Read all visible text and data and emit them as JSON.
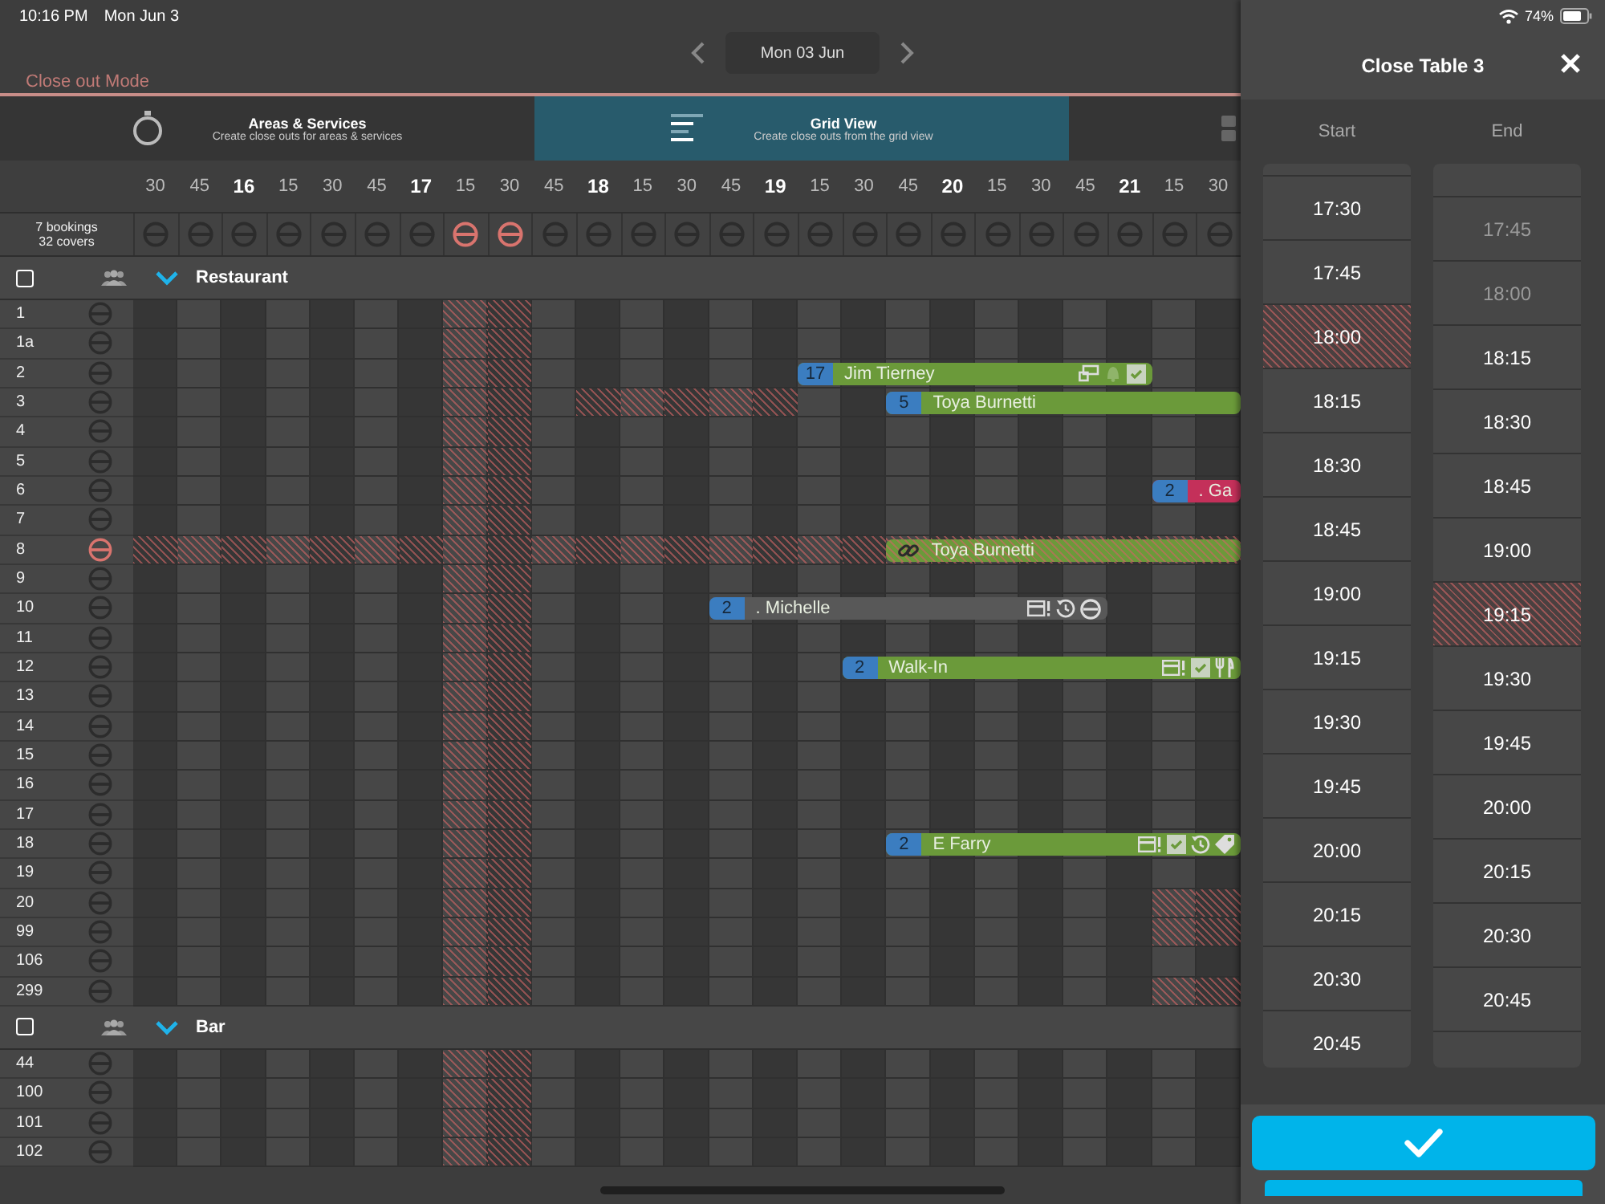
{
  "status_bar": {
    "time": "10:16 PM",
    "date": "Mon Jun 3",
    "battery": "74%"
  },
  "date_nav": {
    "date": "Mon 03 Jun"
  },
  "mode_label": "Close out Mode",
  "tabs": [
    {
      "title": "Areas & Services",
      "subtitle": "Create close outs for areas & services",
      "selected": false
    },
    {
      "title": "Grid View",
      "subtitle": "Create close outs from the grid view",
      "selected": true
    },
    {
      "selected": false
    }
  ],
  "summary": {
    "bookings": "7 bookings",
    "covers": "32 covers"
  },
  "columns": [
    {
      "label": "30",
      "major": false,
      "closed": false
    },
    {
      "label": "45",
      "major": false,
      "closed": false
    },
    {
      "label": "16",
      "major": true,
      "closed": false
    },
    {
      "label": "15",
      "major": false,
      "closed": false
    },
    {
      "label": "30",
      "major": false,
      "closed": false
    },
    {
      "label": "45",
      "major": false,
      "closed": false
    },
    {
      "label": "17",
      "major": true,
      "closed": false
    },
    {
      "label": "15",
      "major": false,
      "closed": true
    },
    {
      "label": "30",
      "major": false,
      "closed": true
    },
    {
      "label": "45",
      "major": false,
      "closed": false
    },
    {
      "label": "18",
      "major": true,
      "closed": false
    },
    {
      "label": "15",
      "major": false,
      "closed": false
    },
    {
      "label": "30",
      "major": false,
      "closed": false
    },
    {
      "label": "45",
      "major": false,
      "closed": false
    },
    {
      "label": "19",
      "major": true,
      "closed": false
    },
    {
      "label": "15",
      "major": false,
      "closed": false
    },
    {
      "label": "30",
      "major": false,
      "closed": false
    },
    {
      "label": "45",
      "major": false,
      "closed": false
    },
    {
      "label": "20",
      "major": true,
      "closed": false
    },
    {
      "label": "15",
      "major": false,
      "closed": false
    },
    {
      "label": "30",
      "major": false,
      "closed": false
    },
    {
      "label": "45",
      "major": false,
      "closed": false
    },
    {
      "label": "21",
      "major": true,
      "closed": false
    },
    {
      "label": "15",
      "major": false,
      "closed": false
    },
    {
      "label": "30",
      "major": false,
      "closed": false
    }
  ],
  "sections": [
    {
      "name": "Restaurant",
      "expanded": true,
      "checked": false,
      "rows": [
        {
          "table": "1",
          "closed": false
        },
        {
          "table": "1a",
          "closed": false
        },
        {
          "table": "2",
          "closed": false,
          "bookings": [
            {
              "covers": "17",
              "name": "Jim Tierney",
              "color": "#6b9a3a",
              "linked": false,
              "icons": [
                {
                  "kind": "table"
                },
                {
                  "kind": "bell"
                },
                {
                  "kind": "check"
                }
              ]
            }
          ]
        },
        {
          "table": "3",
          "closed": false,
          "partial_closeout": true,
          "bookings": [
            {
              "covers": "5",
              "name": "Toya Burnetti",
              "color": "#6b9a3a",
              "linked": false
            }
          ]
        },
        {
          "table": "4",
          "closed": false
        },
        {
          "table": "5",
          "closed": false
        },
        {
          "table": "6",
          "closed": false,
          "bookings": [
            {
              "covers": "2",
              "name": ". Ga",
              "color": "#c4305a",
              "linked": false
            }
          ]
        },
        {
          "table": "7",
          "closed": false
        },
        {
          "table": "8",
          "closed": true,
          "bookings": [
            {
              "name": "Toya Burnetti",
              "color": "#6b9a3a",
              "linked": true
            }
          ]
        },
        {
          "table": "9",
          "closed": false
        },
        {
          "table": "10",
          "closed": false,
          "bookings": [
            {
              "covers": "2",
              "name": ". Michelle",
              "color": "#585858",
              "linked": false,
              "icons": [
                {
                  "kind": "card"
                },
                {
                  "kind": "history"
                },
                {
                  "kind": "blocked"
                }
              ]
            }
          ]
        },
        {
          "table": "11",
          "closed": false
        },
        {
          "table": "12",
          "closed": false,
          "bookings": [
            {
              "covers": "2",
              "name": "Walk-In",
              "color": "#6b9a3a",
              "linked": false,
              "icons": [
                {
                  "kind": "card"
                },
                {
                  "kind": "check"
                },
                {
                  "kind": "cutlery"
                }
              ]
            }
          ]
        },
        {
          "table": "13",
          "closed": false
        },
        {
          "table": "14",
          "closed": false
        },
        {
          "table": "15",
          "closed": false
        },
        {
          "table": "16",
          "closed": false
        },
        {
          "table": "17",
          "closed": false
        },
        {
          "table": "18",
          "closed": false,
          "bookings": [
            {
              "covers": "2",
              "name": "E Farry",
              "color": "#6b9a3a",
              "linked": false,
              "icons": [
                {
                  "kind": "card"
                },
                {
                  "kind": "check"
                },
                {
                  "kind": "history"
                },
                {
                  "kind": "tag"
                }
              ]
            }
          ]
        },
        {
          "table": "19",
          "closed": false
        },
        {
          "table": "20",
          "closed": false,
          "partial_closeout": true
        },
        {
          "table": "99",
          "closed": false,
          "partial_closeout": true
        },
        {
          "table": "106",
          "closed": false
        },
        {
          "table": "299",
          "closed": false,
          "partial_closeout": true
        }
      ]
    },
    {
      "name": "Bar",
      "expanded": true,
      "checked": false,
      "rows": [
        {
          "table": "44",
          "closed": false
        },
        {
          "table": "100",
          "closed": false
        },
        {
          "table": "101",
          "closed": false
        },
        {
          "table": "102",
          "closed": false
        }
      ]
    }
  ],
  "panel": {
    "title": "Close Table 3",
    "pickers": [
      {
        "label": "Start",
        "items": [
          {
            "time": "17:30",
            "selected": false,
            "disabled": false
          },
          {
            "time": "17:45",
            "selected": false,
            "disabled": false
          },
          {
            "time": "18:00",
            "selected": true,
            "disabled": false
          },
          {
            "time": "18:15",
            "selected": false,
            "disabled": false
          },
          {
            "time": "18:30",
            "selected": false,
            "disabled": false
          },
          {
            "time": "18:45",
            "selected": false,
            "disabled": false
          },
          {
            "time": "19:00",
            "selected": false,
            "disabled": false
          },
          {
            "time": "19:15",
            "selected": false,
            "disabled": false
          },
          {
            "time": "19:30",
            "selected": false,
            "disabled": false
          },
          {
            "time": "19:45",
            "selected": false,
            "disabled": false
          },
          {
            "time": "20:00",
            "selected": false,
            "disabled": false
          },
          {
            "time": "20:15",
            "selected": false,
            "disabled": false
          },
          {
            "time": "20:30",
            "selected": false,
            "disabled": false
          },
          {
            "time": "20:45",
            "selected": false,
            "disabled": false
          }
        ]
      },
      {
        "label": "End",
        "items": [
          {
            "time": "17:45",
            "selected": false,
            "disabled": true
          },
          {
            "time": "18:00",
            "selected": false,
            "disabled": true
          },
          {
            "time": "18:15",
            "selected": false,
            "disabled": false
          },
          {
            "time": "18:30",
            "selected": false,
            "disabled": false
          },
          {
            "time": "18:45",
            "selected": false,
            "disabled": false
          },
          {
            "time": "19:00",
            "selected": false,
            "disabled": false
          },
          {
            "time": "19:15",
            "selected": true,
            "disabled": false
          },
          {
            "time": "19:30",
            "selected": false,
            "disabled": false
          },
          {
            "time": "19:45",
            "selected": false,
            "disabled": false
          },
          {
            "time": "20:00",
            "selected": false,
            "disabled": false
          },
          {
            "time": "20:15",
            "selected": false,
            "disabled": false
          },
          {
            "time": "20:30",
            "selected": false,
            "disabled": false
          },
          {
            "time": "20:45",
            "selected": false,
            "disabled": false
          }
        ]
      }
    ]
  }
}
